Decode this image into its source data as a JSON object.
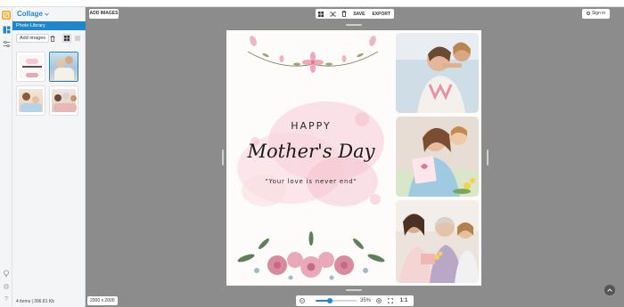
{
  "app": {
    "title": "Collage",
    "accent": "#1f87c9",
    "logo_color": "#f5a623"
  },
  "rail": {
    "icons": [
      "app-logo-icon",
      "layout-grid-icon",
      "sliders-icon",
      "lightbulb-icon",
      "collapse-icon",
      "help-icon"
    ]
  },
  "library": {
    "header": "Photo Library",
    "add_label": "Add images",
    "tools": [
      "trash-icon",
      "grid-view-icon",
      "list-view-icon"
    ],
    "thumbs": [
      "mothers-day-card",
      "mother-daughter-photo",
      "mother-child-photo",
      "family-photo"
    ],
    "footer": "4 items | 396.81 Kb"
  },
  "toolbar": {
    "add_images": "ADD IMAGES",
    "save": "SAVE",
    "export": "EXPORT",
    "sign_in": "Sign in",
    "icons": [
      "layout-icon",
      "shuffle-icon",
      "trash-icon"
    ]
  },
  "card": {
    "happy": "HAPPY",
    "title": "Mother's Day",
    "quote": "\"Your love is never end\""
  },
  "status": {
    "dimensions": "2000 x 2000",
    "zoom": "35%",
    "zoom_fraction": 0.35,
    "ratio": "1:1"
  }
}
